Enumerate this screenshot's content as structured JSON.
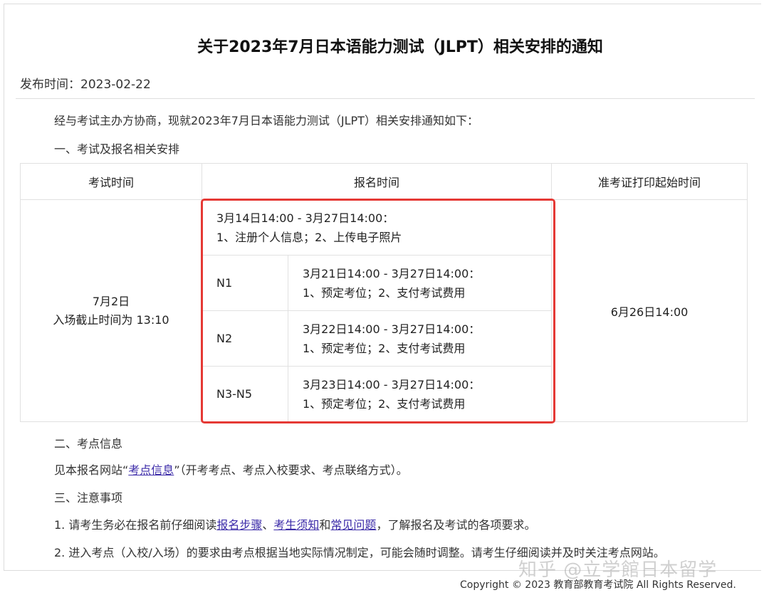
{
  "notice": {
    "title": "关于2023年7月日本语能力测试（JLPT）相关安排的通知",
    "pubtime": "发布时间：2023-02-22",
    "intro": "经与考试主办方协商，现就2023年7月日本语能力测试（JLPT）相关安排通知如下：",
    "section1": "一、考试及报名相关安排"
  },
  "table": {
    "headers": [
      "考试时间",
      "报名时间",
      "准考证打印起始时间"
    ],
    "exam_date": "7月2日",
    "exam_cutoff": "入场截止时间为 13:10",
    "reg_general_window": "3月14日14:00 - 3月27日14:00：",
    "reg_general_tasks": "1、注册个人信息；2、上传电子照片",
    "levels": [
      {
        "level": "N1",
        "window": "3月21日14:00 - 3月27日14:00：",
        "tasks": "1、预定考位；2、支付考试费用"
      },
      {
        "level": "N2",
        "window": "3月22日14:00 - 3月27日14:00：",
        "tasks": "1、预定考位；2、支付考试费用"
      },
      {
        "level": "N3-N5",
        "window": "3月23日14:00 - 3月27日14:00：",
        "tasks": "1、预定考位；2、支付考试费用"
      }
    ],
    "print_start": "6月26日14:00"
  },
  "section2": {
    "heading": "二、考点信息",
    "text_before": "见本报名网站“",
    "link": "考点信息",
    "text_after": "”（开考考点、考点入校要求、考点联络方式）。"
  },
  "section3": {
    "heading": "三、注意事项",
    "item1_prefix": "1. 请考生务必在报名前仔细阅读",
    "item1_link1": "报名步骤",
    "item1_sep1": "、",
    "item1_link2": "考生须知",
    "item1_sep2": "和",
    "item1_link3": "常见问题",
    "item1_suffix": "，了解报名及考试的各项要求。",
    "item2": "2. 进入考点（入校/入场）的要求由考点根据当地实际情况制定，可能会随时调整。请考生仔细阅读并及时关注考点网站。"
  },
  "footer": {
    "copyright": "Copyright © 2023 教育部教育考试院 All Rights Reserved.",
    "watermark": "知乎 @立学館日本留学"
  },
  "colors": {
    "highlight_box": "#e53935",
    "link": "#3b2aa8"
  }
}
